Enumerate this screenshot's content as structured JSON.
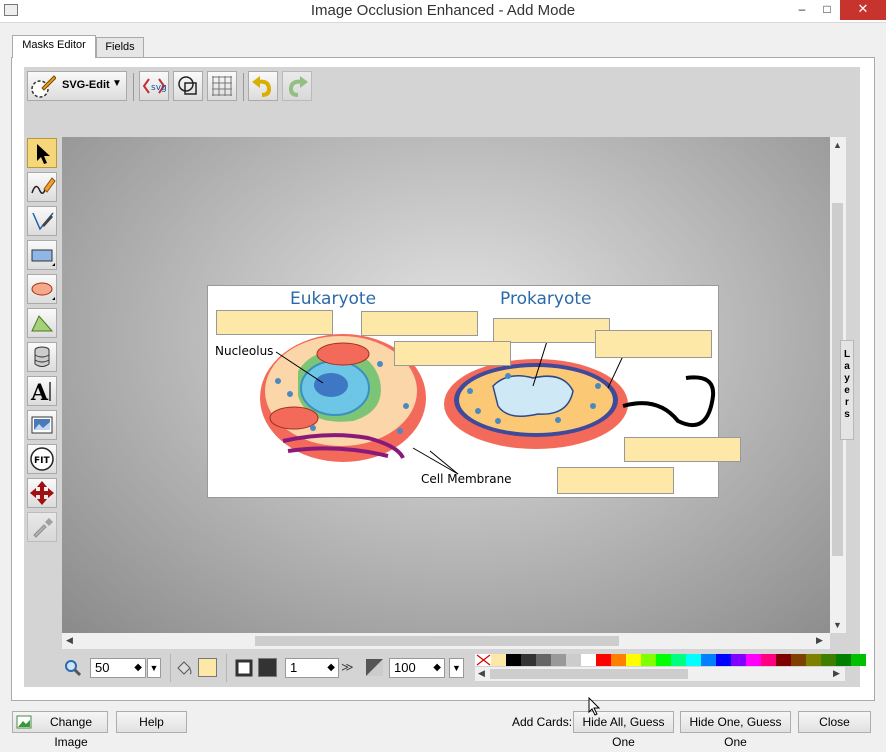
{
  "window": {
    "title": "Image Occlusion Enhanced - Add Mode",
    "minimize": "–",
    "maximize": "□",
    "close": "✕"
  },
  "tabs": [
    {
      "label": "Masks Editor"
    },
    {
      "label": "Fields"
    }
  ],
  "toolbar": {
    "svg_edit_label": "SVG-Edit"
  },
  "image": {
    "title_eukaryote": "Eukaryote",
    "title_prokaryote": "Prokaryote",
    "label_nucleolus": "Nucleolus",
    "label_cell_membrane": "Cell Membrane"
  },
  "bottom": {
    "zoom_value": "50",
    "stroke_width": "1",
    "opacity": "100",
    "more": "≫"
  },
  "palette": [
    "#fde8a7",
    "#000000",
    "#333333",
    "#666666",
    "#999999",
    "#cccccc",
    "#ffffff",
    "#ff0000",
    "#ff7f00",
    "#ffff00",
    "#7fff00",
    "#00ff00",
    "#00ff7f",
    "#00ffff",
    "#007fff",
    "#0000ff",
    "#7f00ff",
    "#ff00ff",
    "#ff007f",
    "#7f0000",
    "#7f3f00",
    "#7f7f00",
    "#3f7f00",
    "#007f00",
    "#00c000"
  ],
  "colors": {
    "fill": "#fde8a7",
    "stroke": "#333333"
  },
  "footer": {
    "change_image": "Change Image",
    "help": "Help",
    "add_cards_label": "Add Cards:",
    "hide_all": "Hide All, Guess One",
    "hide_one": "Hide One, Guess One",
    "close": "Close"
  },
  "layers": {
    "label": "Layers"
  }
}
